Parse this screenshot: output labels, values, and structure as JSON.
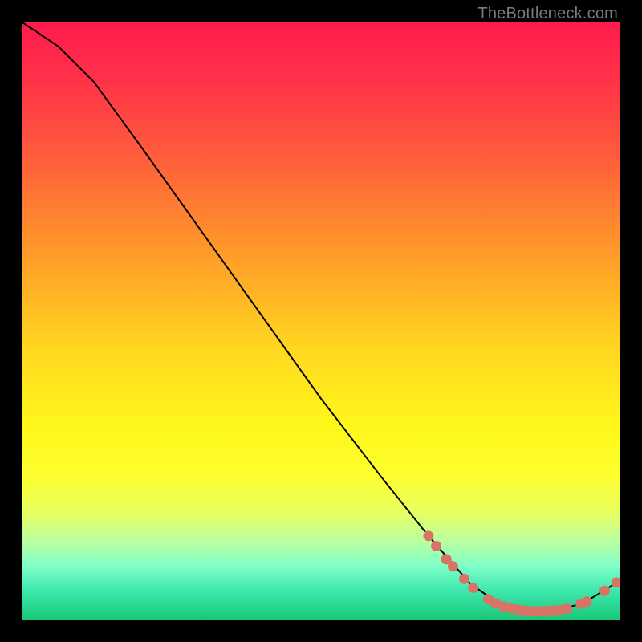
{
  "watermark": "TheBottleneck.com",
  "chart_data": {
    "type": "line",
    "title": "",
    "xlabel": "",
    "ylabel": "",
    "xlim": [
      0,
      100
    ],
    "ylim": [
      0,
      100
    ],
    "grid": false,
    "curve": [
      {
        "x": 0,
        "y": 100
      },
      {
        "x": 6,
        "y": 96
      },
      {
        "x": 12,
        "y": 90
      },
      {
        "x": 20,
        "y": 79
      },
      {
        "x": 30,
        "y": 65
      },
      {
        "x": 40,
        "y": 51
      },
      {
        "x": 50,
        "y": 37
      },
      {
        "x": 60,
        "y": 24
      },
      {
        "x": 68,
        "y": 14
      },
      {
        "x": 75,
        "y": 6
      },
      {
        "x": 80,
        "y": 2.5
      },
      {
        "x": 85,
        "y": 1.4
      },
      {
        "x": 90,
        "y": 1.6
      },
      {
        "x": 94,
        "y": 2.8
      },
      {
        "x": 98,
        "y": 5.2
      },
      {
        "x": 100,
        "y": 6.6
      }
    ],
    "points": [
      {
        "x": 68.0,
        "y": 14.0
      },
      {
        "x": 69.3,
        "y": 12.3
      },
      {
        "x": 71.0,
        "y": 10.1
      },
      {
        "x": 72.1,
        "y": 8.9
      },
      {
        "x": 74.0,
        "y": 6.8
      },
      {
        "x": 75.5,
        "y": 5.3
      },
      {
        "x": 78.0,
        "y": 3.4
      },
      {
        "x": 79.2,
        "y": 2.7
      },
      {
        "x": 80.5,
        "y": 2.2
      },
      {
        "x": 81.6,
        "y": 1.9
      },
      {
        "x": 82.7,
        "y": 1.7
      },
      {
        "x": 83.7,
        "y": 1.55
      },
      {
        "x": 84.7,
        "y": 1.45
      },
      {
        "x": 85.7,
        "y": 1.4
      },
      {
        "x": 86.7,
        "y": 1.4
      },
      {
        "x": 87.8,
        "y": 1.45
      },
      {
        "x": 88.9,
        "y": 1.5
      },
      {
        "x": 90.0,
        "y": 1.6
      },
      {
        "x": 91.2,
        "y": 1.8
      },
      {
        "x": 93.5,
        "y": 2.6
      },
      {
        "x": 94.5,
        "y": 3.0
      },
      {
        "x": 97.5,
        "y": 4.8
      },
      {
        "x": 99.5,
        "y": 6.2
      }
    ]
  }
}
